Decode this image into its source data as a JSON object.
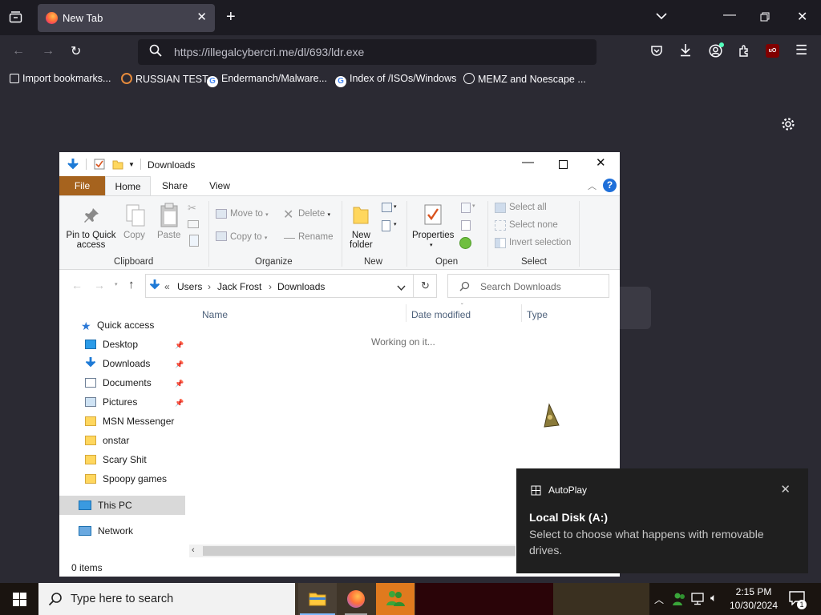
{
  "browser": {
    "tab_title": "New Tab",
    "url": "https://illegalcybercri.me/dl/693/ldr.exe",
    "bookmarks": [
      "Import bookmarks...",
      "RUSSIAN TEST",
      "Endermanch/Malware...",
      "Index of /ISOs/Windows",
      "MEMZ and Noescape ..."
    ]
  },
  "explorer": {
    "title": "Downloads",
    "tabs": [
      "File",
      "Home",
      "Share",
      "View"
    ],
    "ribbon": {
      "pin_line1": "Pin to Quick",
      "pin_line2": "access",
      "copy": "Copy",
      "paste": "Paste",
      "move_to": "Move to",
      "copy_to": "Copy to",
      "delete": "Delete",
      "rename": "Rename",
      "new_folder_line1": "New",
      "new_folder_line2": "folder",
      "properties": "Properties",
      "select_all": "Select all",
      "select_none": "Select none",
      "invert_selection": "Invert selection",
      "groups": [
        "Clipboard",
        "Organize",
        "New",
        "Open",
        "Select"
      ]
    },
    "address": {
      "crumbs": [
        "Users",
        "Jack Frost",
        "Downloads"
      ]
    },
    "search_placeholder": "Search Downloads",
    "nav": {
      "quick_access": "Quick access",
      "items": [
        "Desktop",
        "Downloads",
        "Documents",
        "Pictures",
        "MSN Messenger",
        "onstar",
        "Scary Shit",
        "Spoopy games"
      ],
      "this_pc": "This PC",
      "network": "Network"
    },
    "columns": [
      "Name",
      "Date modified",
      "Type"
    ],
    "loading": "Working on it...",
    "status": "0 items"
  },
  "toast": {
    "app": "AutoPlay",
    "title": "Local Disk (A:)",
    "body": "Select to choose what happens with removable drives."
  },
  "taskbar": {
    "search_placeholder": "Type here to search",
    "time": "2:15 PM",
    "date": "10/30/2024",
    "notif_count": "1"
  }
}
